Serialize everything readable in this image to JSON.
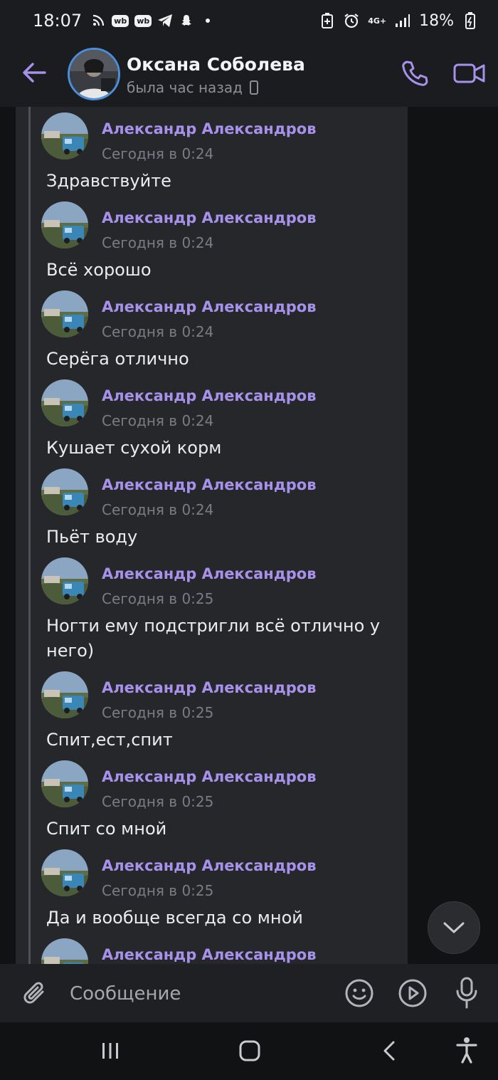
{
  "status_bar": {
    "time": "18:07",
    "wb_badge_1": "wb",
    "wb_badge_2": "wb",
    "network": "4G+",
    "battery": "18%"
  },
  "header": {
    "contact_name": "Оксана Соболева",
    "last_seen": "была час назад"
  },
  "messages": [
    {
      "author": "Александр Александров",
      "time": "Сегодня в 0:24",
      "text": "Здравствуйте"
    },
    {
      "author": "Александр Александров",
      "time": "Сегодня в 0:24",
      "text": "Всё хорошо"
    },
    {
      "author": "Александр Александров",
      "time": "Сегодня в 0:24",
      "text": "Серёга отлично"
    },
    {
      "author": "Александр Александров",
      "time": "Сегодня в 0:24",
      "text": "Кушает сухой корм"
    },
    {
      "author": "Александр Александров",
      "time": "Сегодня в 0:24",
      "text": "Пьёт воду"
    },
    {
      "author": "Александр Александров",
      "time": "Сегодня в 0:25",
      "text": "Ногти ему подстригли всё отлично у него)"
    },
    {
      "author": "Александр Александров",
      "time": "Сегодня в 0:25",
      "text": "Спит,ест,спит"
    },
    {
      "author": "Александр Александров",
      "time": "Сегодня в 0:25",
      "text": "Спит со мной"
    },
    {
      "author": "Александр Александров",
      "time": "Сегодня в 0:25",
      "text": "Да и вообще всегда со мной"
    },
    {
      "author": "Александр Александров"
    }
  ],
  "composer": {
    "placeholder": "Сообщение"
  },
  "colors": {
    "accent": "#a791ea",
    "background": "#111214",
    "bubble": "#26272b"
  },
  "icons": [
    "back-arrow-icon",
    "phone-icon",
    "video-camera-icon",
    "paperclip-icon",
    "emoji-icon",
    "sticker-play-icon",
    "microphone-icon",
    "chevron-down-icon"
  ]
}
